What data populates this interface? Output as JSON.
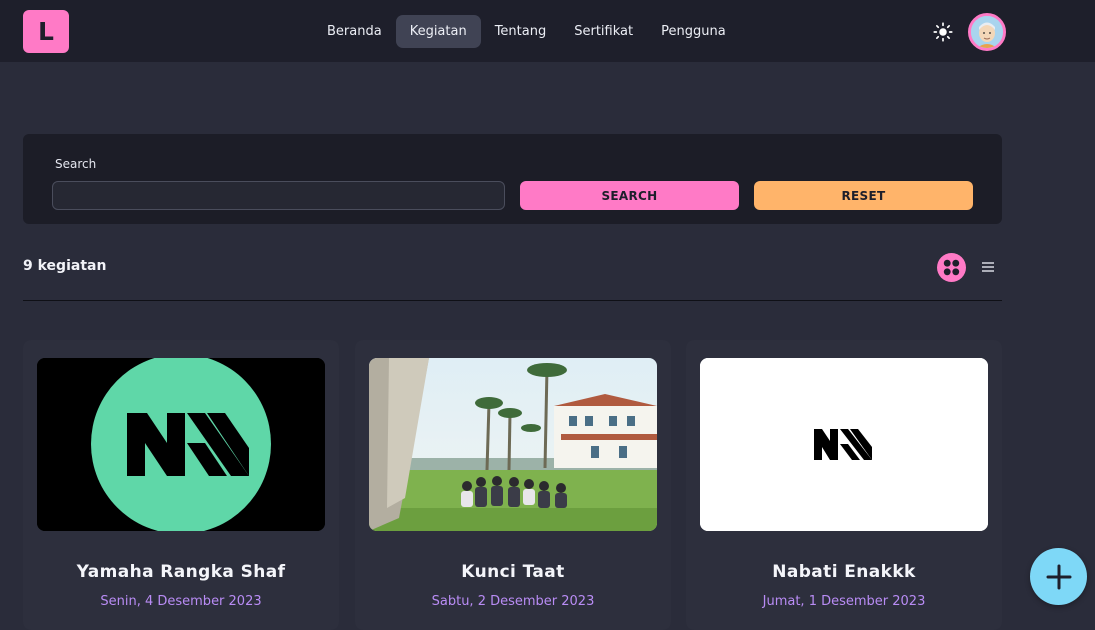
{
  "brand": {
    "logo_letter": "L",
    "accent": "#ff7ac6"
  },
  "nav": {
    "items": [
      {
        "label": "Beranda",
        "active": false
      },
      {
        "label": "Kegiatan",
        "active": true
      },
      {
        "label": "Tentang",
        "active": false
      },
      {
        "label": "Sertifikat",
        "active": false
      },
      {
        "label": "Pengguna",
        "active": false
      }
    ],
    "theme_icon": "sun-icon",
    "avatar_icon": "user-avatar"
  },
  "search": {
    "label": "Search",
    "value": "",
    "placeholder": "",
    "search_button": "SEARCH",
    "reset_button": "RESET",
    "search_color": "#ff7ac6",
    "reset_color": "#ffb46a"
  },
  "toolbar": {
    "count_text": "9 kegiatan",
    "grid_view_icon": "grid-view-icon",
    "list_view_icon": "list-view-icon",
    "active_view": "grid"
  },
  "cards": [
    {
      "title": "Yamaha Rangka Shaf",
      "date": "Senin, 4 Desember 2023",
      "image": "green-circle-logo"
    },
    {
      "title": "Kunci Taat",
      "date": "Sabtu, 2 Desember 2023",
      "image": "campus-lawn-photo"
    },
    {
      "title": "Nabati Enakkk",
      "date": "Jumat, 1 Desember 2023",
      "image": "white-logo"
    }
  ],
  "fab": {
    "icon": "plus-icon",
    "color": "#7ed8f7"
  }
}
